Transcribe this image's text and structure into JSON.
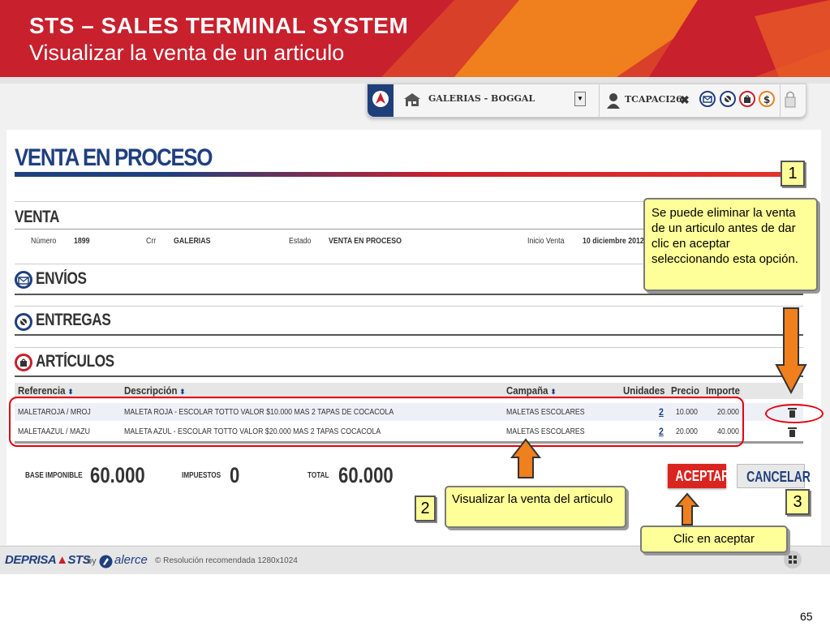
{
  "slide": {
    "title": "STS – SALES  TERMINAL SYSTEM",
    "subtitle": "Visualizar la venta de un articulo",
    "page_number": "65"
  },
  "toolbar": {
    "store": "GALERIAS - BOGGAL",
    "user": "TCAPACI26",
    "close": "✖"
  },
  "page": {
    "title": "VENTA EN PROCESO"
  },
  "venta": {
    "heading": "VENTA",
    "numero_label": "Número",
    "numero": "1899",
    "crr_label": "Crr",
    "crr": "GALERIAS",
    "estado_label": "Estado",
    "estado": "VENTA EN PROCESO",
    "inicio_label": "Inicio Venta",
    "inicio": "10 diciembre 2012"
  },
  "sections": {
    "envios": "ENVÍOS",
    "entregas": "ENTREGAS",
    "articulos": "ARTÍCULOS"
  },
  "table": {
    "headers": {
      "referencia": "Referencia",
      "descripcion": "Descripción",
      "campana": "Campaña",
      "unidades": "Unidades",
      "precio": "Precio",
      "importe": "Importe"
    },
    "sort_glyph": "⬍",
    "rows": [
      {
        "referencia": "MALETAROJA / MROJ",
        "descripcion": "MALETA ROJA - ESCOLAR TOTTO VALOR $10.000 MAS 2 TAPAS DE COCACOLA",
        "campana": "MALETAS ESCOLARES",
        "unidades": "2",
        "precio": "10.000",
        "importe": "20.000"
      },
      {
        "referencia": "MALETAAZUL / MAZU",
        "descripcion": "MALETA AZUL - ESCOLAR TOTTO VALOR $20.000 MAS 2 TAPAS COCACOLA",
        "campana": "MALETAS ESCOLARES",
        "unidades": "2",
        "precio": "20.000",
        "importe": "40.000"
      }
    ]
  },
  "totals": {
    "base_label": "BASE IMPONIBLE",
    "base": "60.000",
    "impuestos_label": "IMPUESTOS",
    "impuestos": "0",
    "total_label": "TOTAL",
    "total": "60.000"
  },
  "buttons": {
    "aceptar": "ACEPTAR",
    "cancelar": "CANCELAR"
  },
  "footer": {
    "brand_a": "DEPRISA",
    "brand_b": "STS",
    "by": "by",
    "alerce": "alerce",
    "note": "© Resolución recomendada 1280x1024"
  },
  "annotations": {
    "n1": "1",
    "n2": "2",
    "n3": "3",
    "callout_delete": "Se puede eliminar la venta de un articulo antes de dar clic en aceptar seleccionando esta opción.",
    "callout_view": "Visualizar la venta del articulo",
    "callout_accept": "Clic en aceptar"
  },
  "colors": {
    "brand_red": "#c8202d",
    "brand_blue": "#1f3f7e",
    "callout_yellow": "#ffff99",
    "arrow_orange": "#f07f1d"
  }
}
